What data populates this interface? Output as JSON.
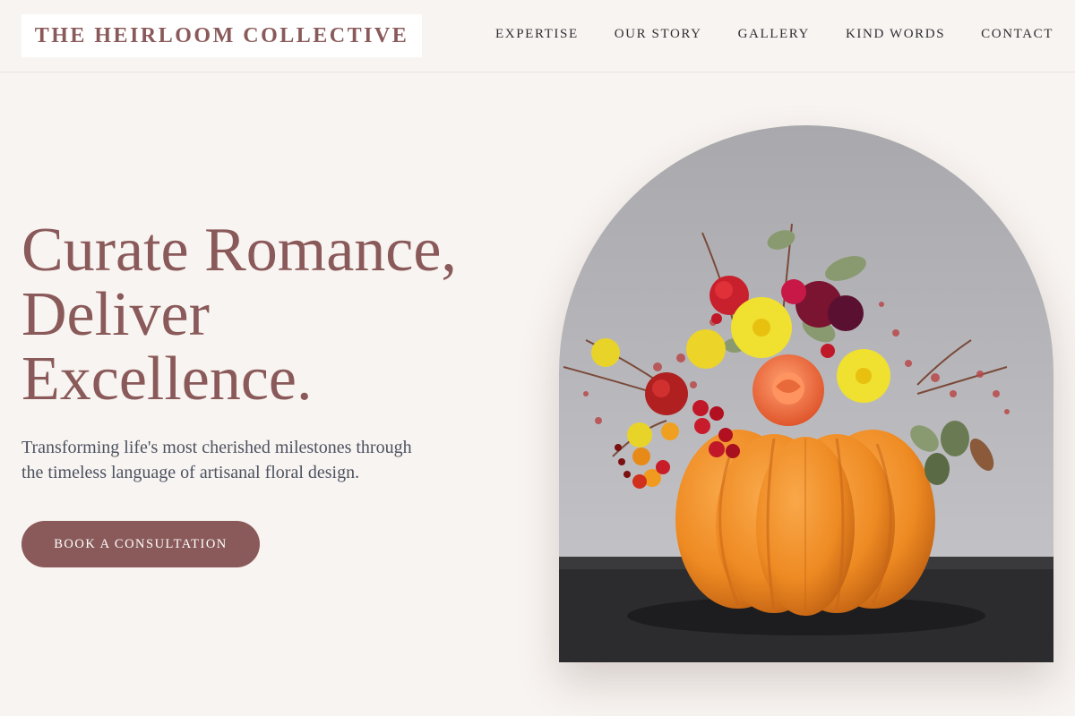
{
  "brand": {
    "name": "THE HEIRLOOM COLLECTIVE"
  },
  "nav": {
    "items": [
      {
        "label": "EXPERTISE"
      },
      {
        "label": "OUR STORY"
      },
      {
        "label": "GALLERY"
      },
      {
        "label": "KIND WORDS"
      },
      {
        "label": "CONTACT"
      }
    ]
  },
  "hero": {
    "headline_lines": [
      "Curate Romance,",
      "Deliver",
      "Excellence."
    ],
    "subtext": "Transforming life's most cherished milestones through the timeless language of artisanal floral design.",
    "cta_label": "BOOK A CONSULTATION",
    "image_subject": "pumpkin-floral-arrangement"
  },
  "colors": {
    "background": "#f8f4f1",
    "accent": "#8a5a5a",
    "nav_text": "#2e2e33",
    "body_text": "#4c5260"
  }
}
